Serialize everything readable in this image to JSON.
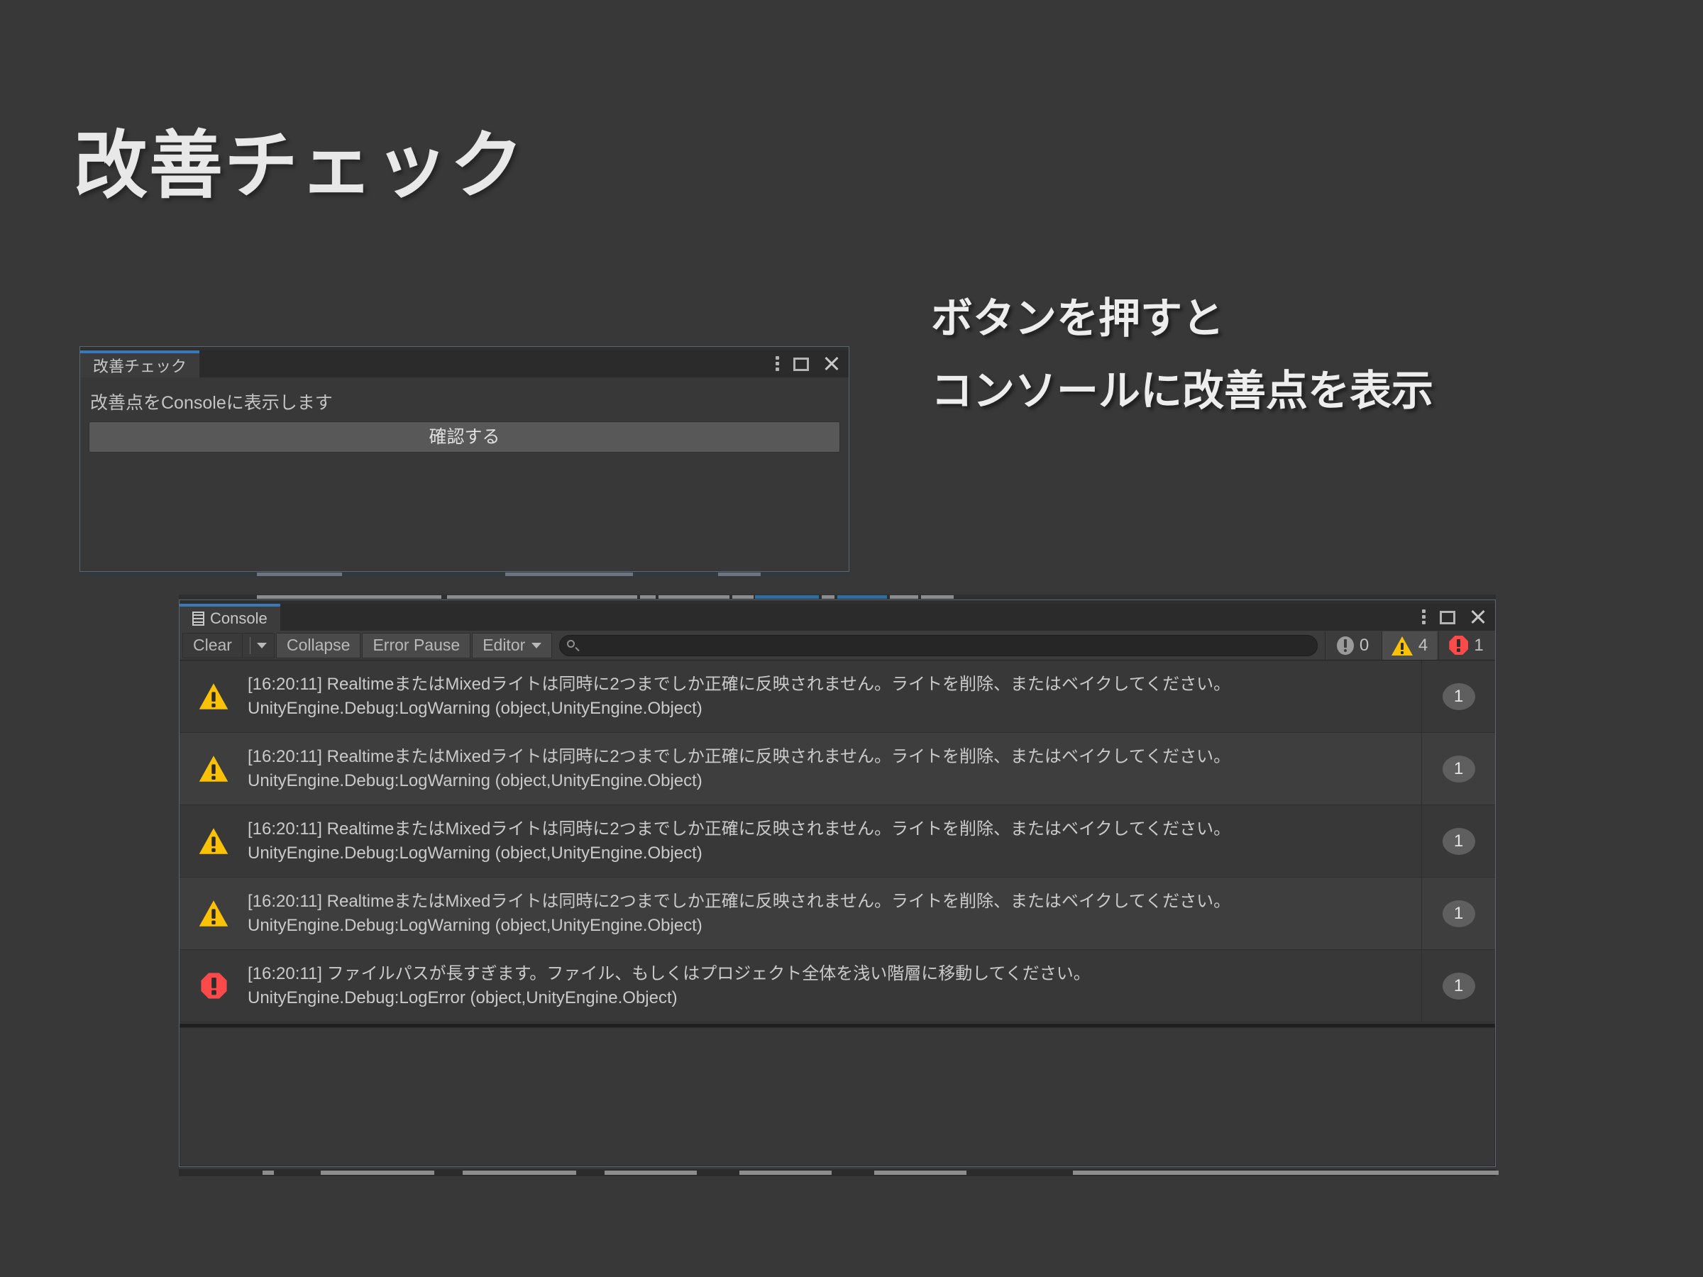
{
  "slide": {
    "title": "改善チェック",
    "annotations": [
      "ボタンを押すと",
      "コンソールに改善点を表示"
    ],
    "background_color": "#383838",
    "text_color": "#e8e8e8"
  },
  "check_window": {
    "tab_label": "改善チェック",
    "description": "改善点をConsoleに表示します",
    "confirm_label": "確認する",
    "controls": [
      "kebab-menu-icon",
      "maximize-icon",
      "close-icon"
    ]
  },
  "console_window": {
    "tab_label": "Console",
    "tab_icon": "console-log-icon",
    "controls": [
      "kebab-menu-icon",
      "maximize-icon",
      "close-icon"
    ],
    "toolbar": {
      "clear_label": "Clear",
      "clear_dropdown_icon": "chevron-down-icon",
      "collapse_label": "Collapse",
      "error_pause_label": "Error Pause",
      "editor_label": "Editor",
      "editor_dropdown_icon": "chevron-down-icon"
    },
    "search": {
      "value": "",
      "placeholder": "",
      "icon": "search-icon"
    },
    "counters": [
      {
        "icon": "info-icon",
        "count": "0",
        "color": "#9a9a9a",
        "active": false
      },
      {
        "icon": "warning-icon",
        "count": "4",
        "color": "#f9c208",
        "active": true
      },
      {
        "icon": "error-icon",
        "count": "1",
        "color": "#fc4a4a",
        "active": false
      }
    ],
    "logs": [
      {
        "type": "warning",
        "icon": "warning-icon",
        "line1": "[16:20:11] RealtimeまたはMixedライトは同時に2つまでしか正確に反映されません。ライトを削除、またはベイクしてください。",
        "line2": "UnityEngine.Debug:LogWarning (object,UnityEngine.Object)",
        "count": "1"
      },
      {
        "type": "warning",
        "icon": "warning-icon",
        "line1": "[16:20:11] RealtimeまたはMixedライトは同時に2つまでしか正確に反映されません。ライトを削除、またはベイクしてください。",
        "line2": "UnityEngine.Debug:LogWarning (object,UnityEngine.Object)",
        "count": "1"
      },
      {
        "type": "warning",
        "icon": "warning-icon",
        "line1": "[16:20:11] RealtimeまたはMixedライトは同時に2つまでしか正確に反映されません。ライトを削除、またはベイクしてください。",
        "line2": "UnityEngine.Debug:LogWarning (object,UnityEngine.Object)",
        "count": "1"
      },
      {
        "type": "warning",
        "icon": "warning-icon",
        "line1": "[16:20:11] RealtimeまたはMixedライトは同時に2つまでしか正確に反映されません。ライトを削除、またはベイクしてください。",
        "line2": "UnityEngine.Debug:LogWarning (object,UnityEngine.Object)",
        "count": "1"
      },
      {
        "type": "error",
        "icon": "error-icon",
        "line1": "[16:20:11] ファイルパスが長すぎます。ファイル、もしくはプロジェクト全体を浅い階層に移動してください。",
        "line2": "UnityEngine.Debug:LogError (object,UnityEngine.Object)",
        "count": "1"
      }
    ],
    "detail_text": ""
  }
}
